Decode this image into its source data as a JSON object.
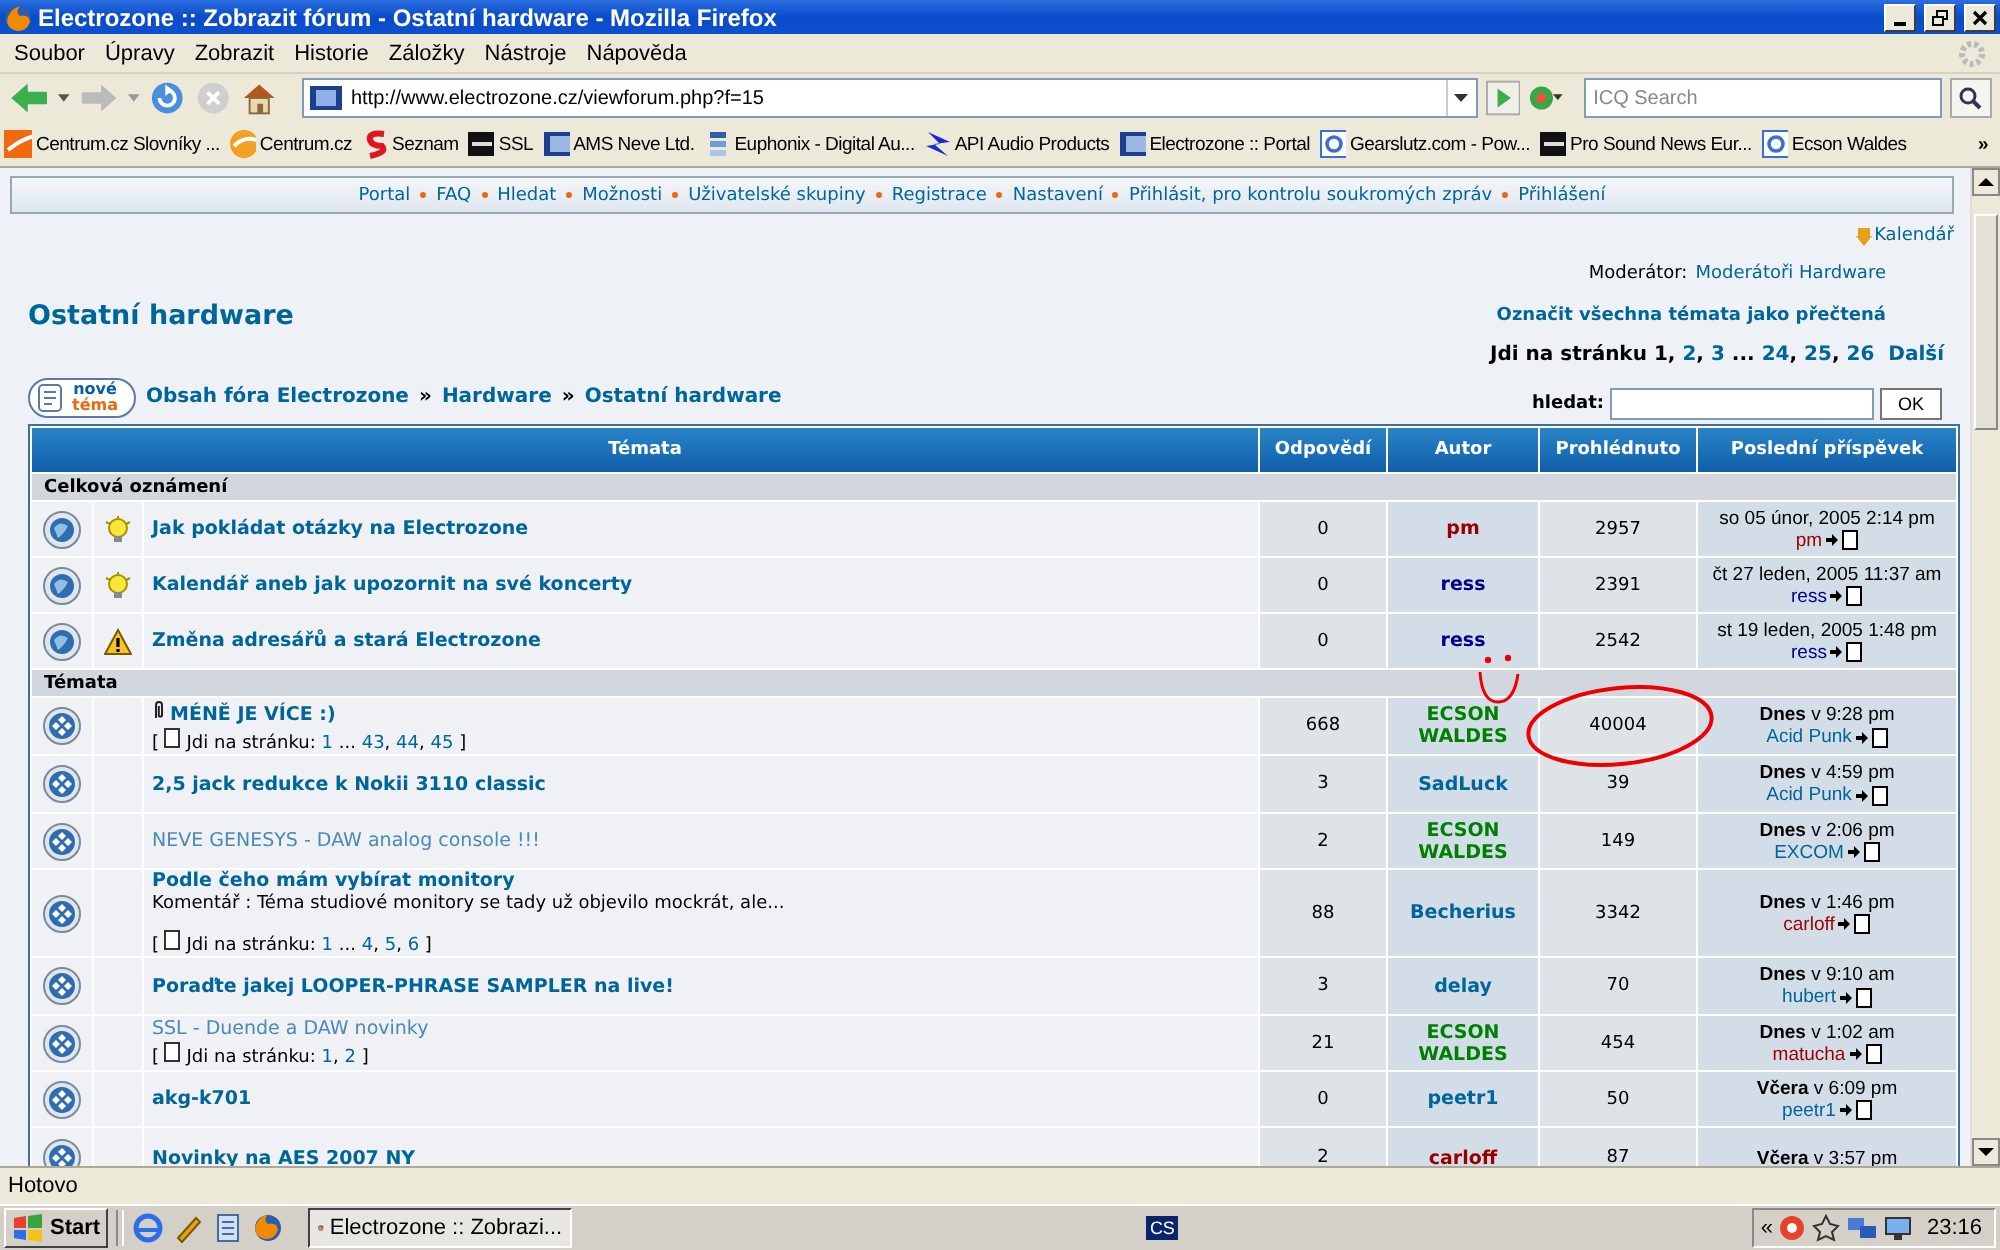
{
  "window": {
    "title": "Electrozone :: Zobrazit fórum - Ostatní hardware - Mozilla Firefox"
  },
  "menu": [
    "Soubor",
    "Úpravy",
    "Zobrazit",
    "Historie",
    "Záložky",
    "Nástroje",
    "Nápověda"
  ],
  "address": {
    "value": "http://www.electrozone.cz/viewforum.php?f=15"
  },
  "search": {
    "placeholder": "ICQ Search"
  },
  "bookmarks": [
    {
      "label": "Centrum.cz Slovníky ...",
      "kind": "swoosh"
    },
    {
      "label": "Centrum.cz",
      "kind": "ball"
    },
    {
      "label": "Seznam",
      "kind": "squiggle"
    },
    {
      "label": "SSL",
      "kind": "dark"
    },
    {
      "label": "AMS Neve Ltd.",
      "kind": "gradient"
    },
    {
      "label": "Euphonix - Digital Au...",
      "kind": "stack"
    },
    {
      "label": "API Audio Products",
      "kind": "bolt"
    },
    {
      "label": "Electrozone :: Portal",
      "kind": "gradient"
    },
    {
      "label": "Gearslutz.com - Pow...",
      "kind": "frame"
    },
    {
      "label": "Pro Sound News Eur...",
      "kind": "dark"
    },
    {
      "label": "Ecson Waldes",
      "kind": "frame"
    }
  ],
  "bookmarks_more": "»",
  "forum": {
    "nav": [
      "Portal",
      "FAQ",
      "Hledat",
      "Možnosti",
      "Uživatelské skupiny",
      "Registrace",
      "Nastavení",
      "Přihlásit, pro kontrolu soukromých zpráv",
      "Přihlášení"
    ],
    "calendar_link": "Kalendář",
    "moderator": {
      "label": "Moderátor:",
      "value": "Moderátoři Hardware"
    },
    "heading": "Ostatní hardware",
    "mark_read": "Označit všechna témata jako přečtená",
    "pagination": {
      "label": "Jdi na stránku",
      "pages": [
        {
          "text": "1",
          "kind": "current"
        },
        {
          "text": ",",
          "kind": "sep"
        },
        {
          "text": "2",
          "kind": "link"
        },
        {
          "text": ",",
          "kind": "sep"
        },
        {
          "text": "3",
          "kind": "link"
        },
        {
          "text": "...",
          "kind": "gap"
        },
        {
          "text": "24",
          "kind": "link"
        },
        {
          "text": ",",
          "kind": "sep"
        },
        {
          "text": "25",
          "kind": "link"
        },
        {
          "text": ",",
          "kind": "sep"
        },
        {
          "text": "26",
          "kind": "link"
        }
      ],
      "next": "Další"
    },
    "new_topic": {
      "line1": "nové",
      "line2": "téma"
    },
    "breadcrumb": [
      {
        "text": "Obsah fóra Electrozone",
        "kind": "link"
      },
      {
        "text": "»",
        "kind": "sep"
      },
      {
        "text": "Hardware",
        "kind": "link"
      },
      {
        "text": "»",
        "kind": "sep"
      },
      {
        "text": "Ostatní hardware",
        "kind": "link"
      }
    ],
    "search_box": {
      "label": "hledat:",
      "button": "OK"
    },
    "table": {
      "columns": [
        "Témata",
        "Odpovědí",
        "Autor",
        "Prohlédnuto",
        "Poslední příspěvek"
      ],
      "sections": [
        {
          "title": "Celková oznámení",
          "rows": [
            {
              "kind": "announcement",
              "badge": {
                "kind": "idea"
              },
              "title": "Jak pokládat otázky na Electrozone",
              "visited": false,
              "attachment": false,
              "replies": "0",
              "author": {
                "name": "pm",
                "color": "#990000"
              },
              "views": "2957",
              "last_date": "so 05 únor, 2005 2:14 pm",
              "last_poster": {
                "name": "pm",
                "color": "#990000"
              }
            },
            {
              "kind": "announcement",
              "badge": {
                "kind": "idea"
              },
              "title": "Kalendář aneb jak upozornit na své koncerty",
              "visited": false,
              "attachment": false,
              "replies": "0",
              "author": {
                "name": "ress",
                "color": "#000088"
              },
              "views": "2391",
              "last_date": "čt 27 leden, 2005 11:37 am",
              "last_poster": {
                "name": "ress",
                "color": "#000088"
              }
            },
            {
              "kind": "announcement",
              "badge": {
                "kind": "warning"
              },
              "title": "Změna adresářů a stará Electrozone",
              "visited": false,
              "attachment": false,
              "replies": "0",
              "author": {
                "name": "ress",
                "color": "#000088"
              },
              "views": "2542",
              "last_date": "st 19 leden, 2005 1:48 pm",
              "last_poster": {
                "name": "ress",
                "color": "#000088"
              }
            }
          ]
        },
        {
          "title": "Témata",
          "rows": [
            {
              "kind": "topic",
              "title": "MÉNĚ JE VÍCE :)",
              "visited": false,
              "attachment": true,
              "pages": {
                "open": "[",
                "label": "Jdi na stránku:",
                "items": [
                  {
                    "text": "1",
                    "kind": "link"
                  },
                  {
                    "text": "...",
                    "kind": "gap"
                  },
                  {
                    "text": "43",
                    "kind": "link"
                  },
                  {
                    "text": ",",
                    "kind": "sep"
                  },
                  {
                    "text": "44",
                    "kind": "link"
                  },
                  {
                    "text": ",",
                    "kind": "sep"
                  },
                  {
                    "text": "45",
                    "kind": "link"
                  }
                ],
                "close": "]"
              },
              "replies": "668",
              "author": {
                "name": "ECSON WALDES",
                "color": "#008000"
              },
              "views": "40004",
              "last_date": "**Dnes** v 9:28 pm",
              "last_poster": {
                "name": "Acid Punk",
                "color": "#006699"
              }
            },
            {
              "kind": "topic",
              "title": "2,5 jack redukce k Nokii 3110 classic",
              "visited": false,
              "attachment": false,
              "replies": "3",
              "author": {
                "name": "SadLuck",
                "color": "#006699"
              },
              "views": "39",
              "last_date": "**Dnes** v 4:59 pm",
              "last_poster": {
                "name": "Acid Punk",
                "color": "#006699"
              }
            },
            {
              "kind": "topic",
              "title": "NEVE GENESYS - DAW analog console !!!",
              "visited": true,
              "attachment": false,
              "replies": "2",
              "author": {
                "name": "ECSON WALDES",
                "color": "#008000"
              },
              "views": "149",
              "last_date": "**Dnes** v 2:06 pm",
              "last_poster": {
                "name": "EXCOM",
                "color": "#006699"
              }
            },
            {
              "kind": "topic",
              "title": "Podle čeho mám vybírat monitory",
              "visited": false,
              "attachment": false,
              "comment": "Komentář : Téma studiové monitory se tady už objevilo mockrát, ale...",
              "pages": {
                "open": "[",
                "label": "Jdi na stránku:",
                "items": [
                  {
                    "text": "1",
                    "kind": "link"
                  },
                  {
                    "text": "...",
                    "kind": "gap"
                  },
                  {
                    "text": "4",
                    "kind": "link"
                  },
                  {
                    "text": ",",
                    "kind": "sep"
                  },
                  {
                    "text": "5",
                    "kind": "link"
                  },
                  {
                    "text": ",",
                    "kind": "sep"
                  },
                  {
                    "text": "6",
                    "kind": "link"
                  }
                ],
                "close": "]"
              },
              "replies": "88",
              "author": {
                "name": "Becherius",
                "color": "#006699"
              },
              "views": "3342",
              "last_date": "**Dnes** v 1:46 pm",
              "last_poster": {
                "name": "carloff",
                "color": "#990000"
              }
            },
            {
              "kind": "topic",
              "title": "Poraďte jakej LOOPER-PHRASE SAMPLER na live!",
              "visited": false,
              "attachment": false,
              "replies": "3",
              "author": {
                "name": "delay",
                "color": "#006699"
              },
              "views": "70",
              "last_date": "**Dnes** v 9:10 am",
              "last_poster": {
                "name": "hubert",
                "color": "#006699"
              }
            },
            {
              "kind": "topic",
              "title": "SSL - Duende a DAW novinky",
              "visited": true,
              "attachment": false,
              "pages": {
                "open": "[",
                "label": "Jdi na stránku:",
                "items": [
                  {
                    "text": "1",
                    "kind": "link"
                  },
                  {
                    "text": ",",
                    "kind": "sep"
                  },
                  {
                    "text": "2",
                    "kind": "link"
                  }
                ],
                "close": "]"
              },
              "replies": "21",
              "author": {
                "name": "ECSON WALDES",
                "color": "#008000"
              },
              "views": "454",
              "last_date": "**Dnes** v 1:02 am",
              "last_poster": {
                "name": "matucha",
                "color": "#990000"
              }
            },
            {
              "kind": "topic",
              "title": "akg-k701",
              "visited": false,
              "attachment": false,
              "replies": "0",
              "author": {
                "name": "peetr1",
                "color": "#006699"
              },
              "views": "50",
              "last_date": "**Včera** v 6:09 pm",
              "last_poster": {
                "name": "peetr1",
                "color": "#006699"
              }
            },
            {
              "kind": "topic",
              "title": "Novinky na AES 2007 NY",
              "visited": false,
              "attachment": false,
              "replies": "2",
              "author": {
                "name": "carloff",
                "color": "#990000"
              },
              "views": "87",
              "last_date": "**Včera** v 3:57 pm"
            }
          ]
        }
      ]
    }
  },
  "status_bar": "Hotovo",
  "taskbar": {
    "start": "Start",
    "tasks": [
      {
        "label": "Electrozone :: Zobrazi...",
        "selected": true
      }
    ],
    "language": "CS",
    "tray_toggle": "«",
    "clock": "23:16"
  }
}
